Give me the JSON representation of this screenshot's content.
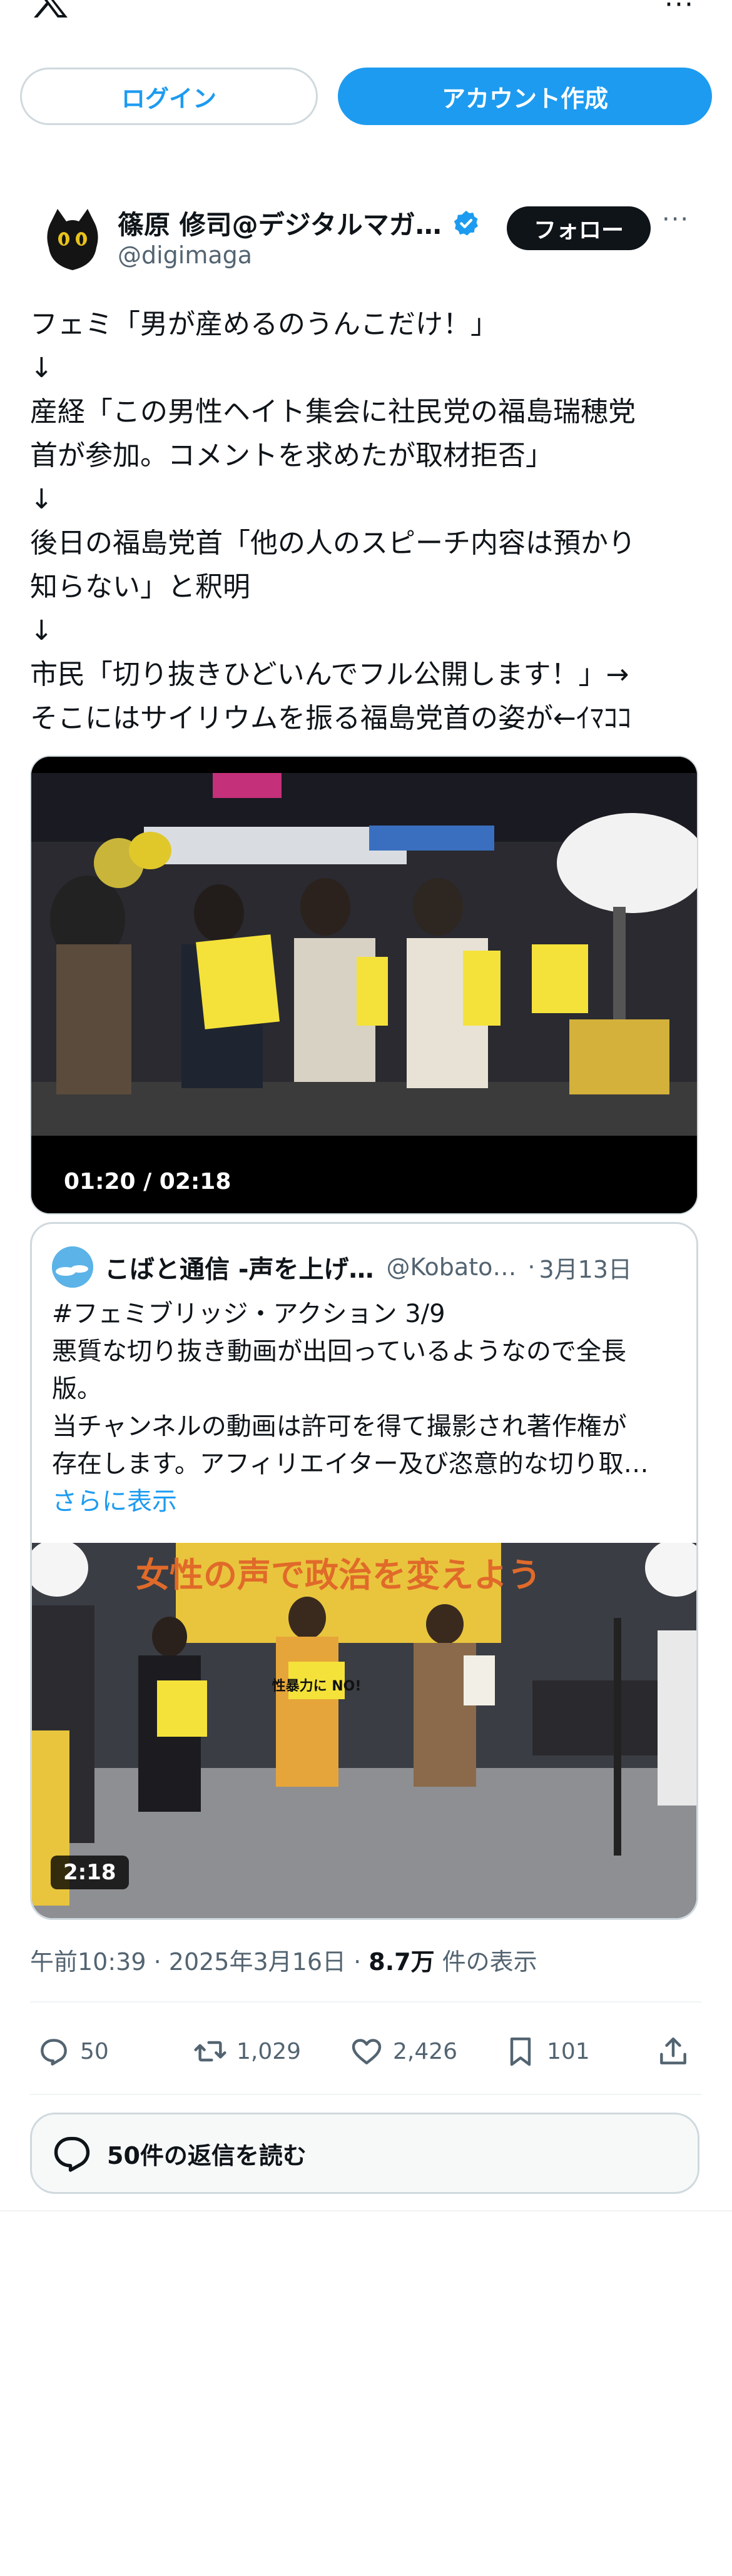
{
  "header": {
    "logo_icon": "x-logo-icon",
    "more_icon": "more-icon",
    "more_label": "···"
  },
  "auth": {
    "login_label": "ログイン",
    "signup_label": "アカウント作成"
  },
  "tweet": {
    "author": {
      "display_name": "篠原 修司@デジタルマガ…",
      "handle": "@digimaga",
      "verified": true,
      "follow_label": "フォロー",
      "more_label": "···"
    },
    "text_lines": [
      "フェミ「男が産めるのうんこだけ！」",
      "↓",
      "産経「この男性ヘイト集会に社民党の福島瑞穂党",
      "首が参加。コメントを求めたが取材拒否」",
      "↓",
      "後日の福島党首「他の人のスピーチ内容は預かり",
      "知らない」と釈明",
      "↓",
      "市民「切り抜きひどいんでフル公開します！」→",
      "そこにはサイリウムを振る福島党首の姿が←ｲﾏｺｺ"
    ],
    "video": {
      "timestamp": "01:20 / 02:18"
    },
    "quote": {
      "display_name": "こばと通信 -声を上げ…",
      "handle": "@Kobato…",
      "separator": "·",
      "date": "3月13日",
      "text_lines": [
        "#フェミブリッジ・アクション 3/9",
        "悪質な切り抜き動画が出回っているようなので全長",
        "版。",
        "当チャンネルの動画は許可を得て撮影され著作権が",
        "存在します。アフィリエイター及び恣意的な切り取…"
      ],
      "show_more": "さらに表示",
      "video_duration": "2:18",
      "banner_text": "女性の声で政治を変えよう",
      "sign_text": "性暴力に NO!"
    },
    "meta": {
      "time": "午前10:39",
      "sep1": " · ",
      "date": "2025年3月16日",
      "sep2": " · ",
      "views": "8.7万",
      "views_label": " 件の表示"
    },
    "actions": {
      "reply_count": "50",
      "retweet_count": "1,029",
      "like_count": "2,426",
      "bookmark_count": "101"
    },
    "read_replies_label": "50件の返信を読む"
  },
  "colors": {
    "accent": "#1d9bf0",
    "text": "#0f1419",
    "muted": "#536471",
    "border": "#cfd9de"
  }
}
